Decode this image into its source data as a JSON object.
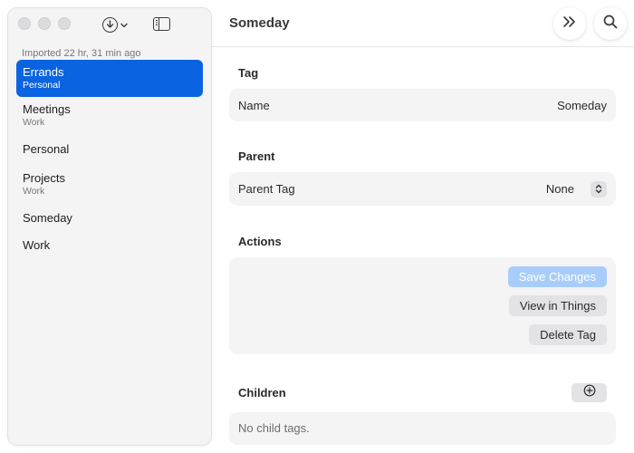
{
  "sidebar": {
    "imported_label": "Imported 22 hr, 31 min ago",
    "items": [
      {
        "name": "Errands",
        "sub": "Personal"
      },
      {
        "name": "Meetings",
        "sub": "Work"
      },
      {
        "name": "Personal"
      },
      {
        "name": "Projects",
        "sub": "Work"
      },
      {
        "name": "Someday"
      },
      {
        "name": "Work"
      }
    ],
    "selected_index": 0
  },
  "header": {
    "title": "Someday"
  },
  "tag_section": {
    "heading": "Tag",
    "name_label": "Name",
    "name_value": "Someday"
  },
  "parent_section": {
    "heading": "Parent",
    "label": "Parent Tag",
    "value": "None"
  },
  "actions_section": {
    "heading": "Actions",
    "save_label": "Save Changes",
    "view_label": "View in Things",
    "delete_label": "Delete Tag"
  },
  "children_section": {
    "heading": "Children",
    "empty_text": "No child tags."
  },
  "colors": {
    "accent": "#0a63e0",
    "disabled_accent": "#a8cdfa"
  },
  "icons": [
    "download-icon",
    "chevron-down-icon",
    "sidebar-toggle-icon",
    "double-chevron-right-icon",
    "search-icon",
    "up-down-chevron-icon",
    "plus-circle-icon"
  ]
}
